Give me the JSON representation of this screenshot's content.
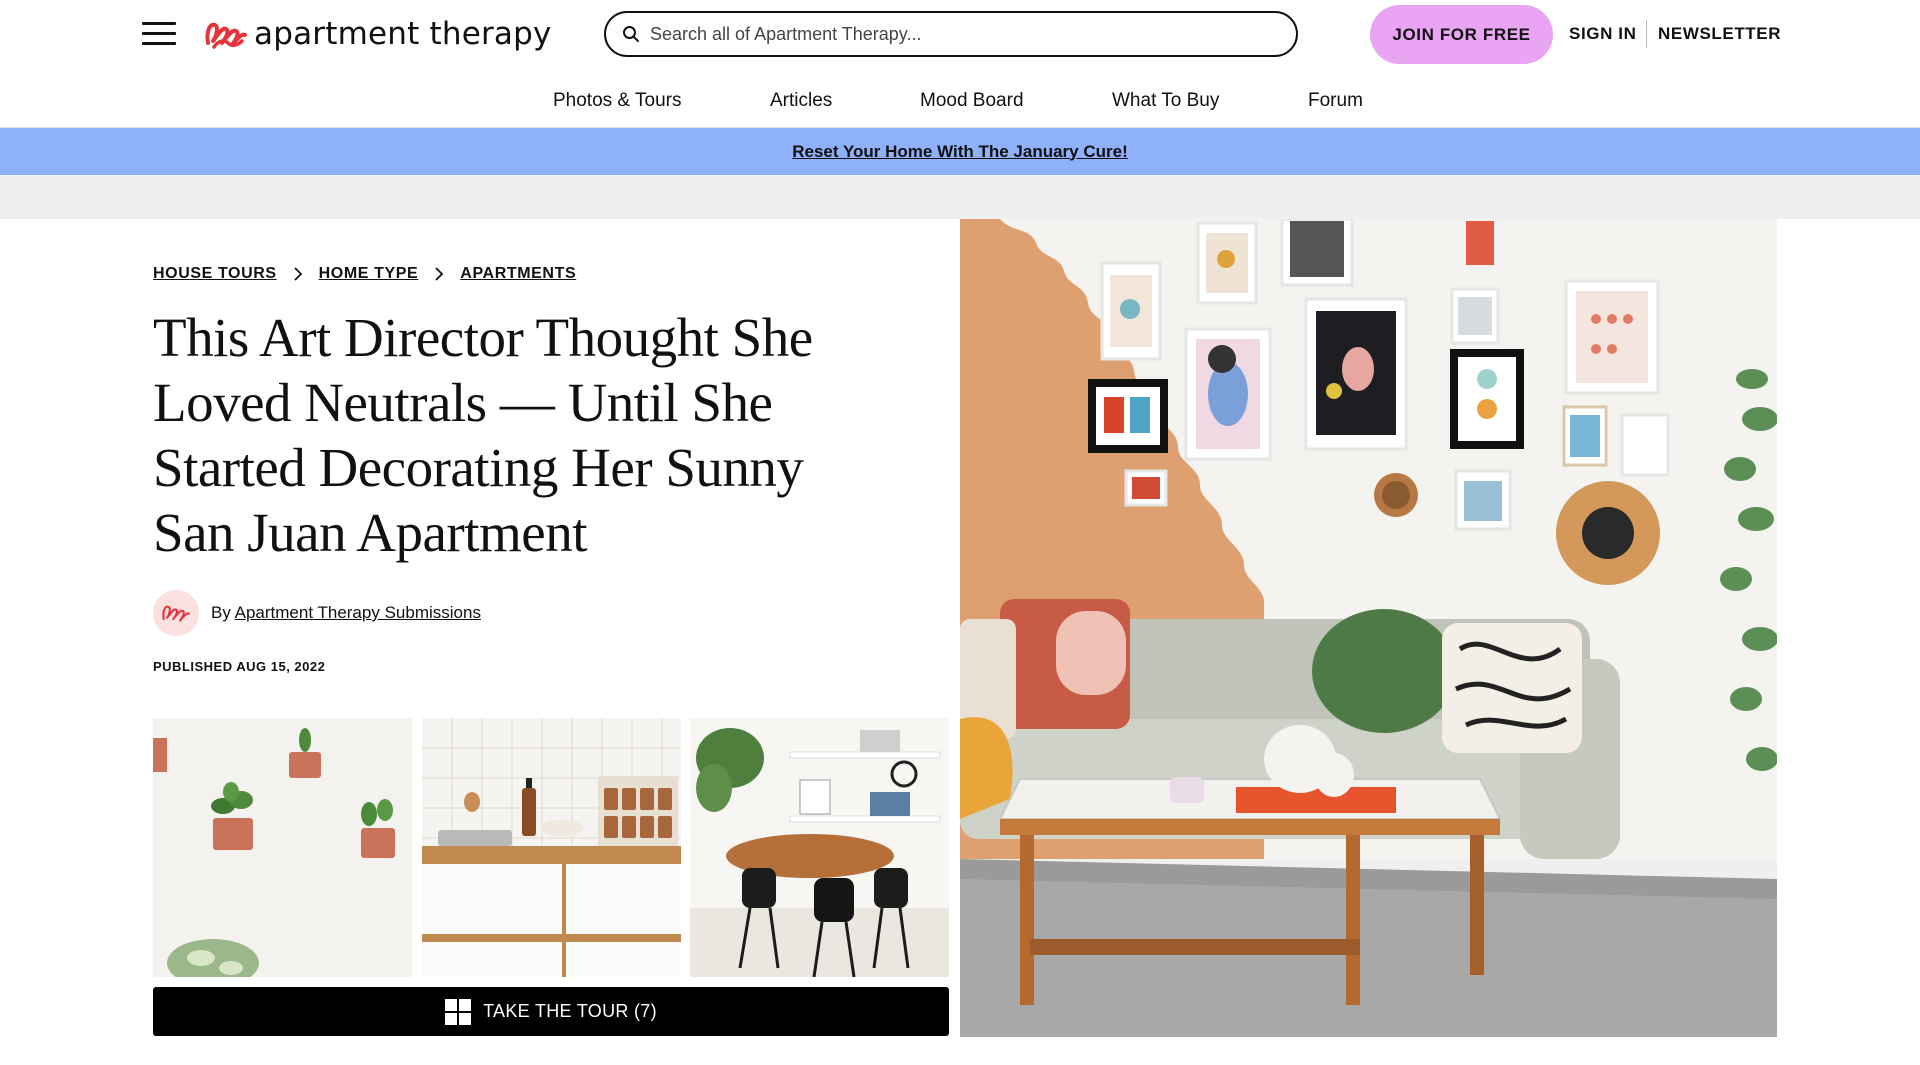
{
  "header": {
    "logo_text": "apartment therapy",
    "search_placeholder": "Search all of Apartment Therapy...",
    "join_label": "JOIN FOR FREE",
    "sign_in_label": "SIGN IN",
    "newsletter_label": "NEWSLETTER"
  },
  "nav": {
    "items": [
      "Photos & Tours",
      "Articles",
      "Mood Board",
      "What To Buy",
      "Forum"
    ]
  },
  "promo": {
    "text": "Reset Your Home With The January Cure!"
  },
  "article": {
    "breadcrumbs": [
      "HOUSE TOURS",
      "HOME TYPE",
      "APARTMENTS"
    ],
    "headline": "This Art Director Thought She Loved Neutrals — Until She Started Decorating Her Sunny San Juan Apartment",
    "byline_prefix": "By",
    "author": "Apartment Therapy Submissions",
    "published": "PUBLISHED AUG 15, 2022",
    "tour_label": "TAKE THE TOUR (7)"
  },
  "icons": {
    "menu": "hamburger-icon",
    "search": "search-icon",
    "breadcrumb_separator": "chevron-right-icon",
    "tour": "grid-icon"
  },
  "colors": {
    "join_button": "#e9a5f3",
    "promo_banner": "#8fb0fb",
    "logo_red": "#e8333a",
    "tour_button": "#000000"
  }
}
